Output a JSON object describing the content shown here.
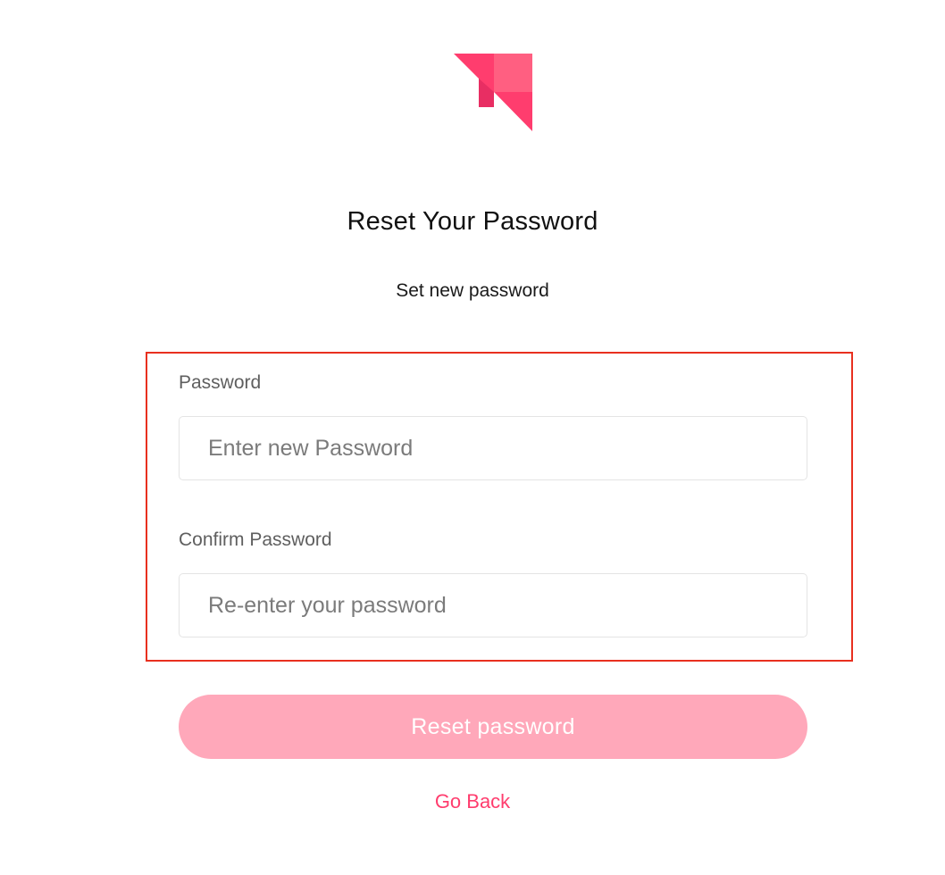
{
  "brand": {
    "logo_icon": "folded-pink-ribbon-logo",
    "colors": {
      "logo_dark": "#f0306a",
      "logo_light": "#ff5a7e",
      "accent": "#ff3d6e",
      "button_disabled": "#ffa8ba"
    }
  },
  "header": {
    "title": "Reset Your Password",
    "subtitle": "Set new password"
  },
  "form": {
    "password": {
      "label": "Password",
      "placeholder": "Enter new Password",
      "value": ""
    },
    "confirm_password": {
      "label": "Confirm Password",
      "placeholder": "Re-enter your password",
      "value": ""
    },
    "submit_label": "Reset password",
    "back_label": "Go Back"
  },
  "annotation": {
    "highlight_color": "#e8301f"
  }
}
